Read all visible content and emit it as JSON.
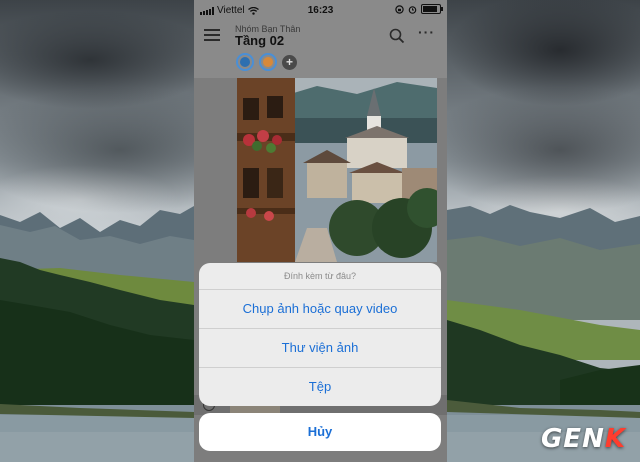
{
  "status_bar": {
    "carrier": "Viettel",
    "time": "16:23"
  },
  "header": {
    "subtitle": "Nhóm Bạn Thân",
    "title": "Tầng 02"
  },
  "action_sheet": {
    "title": "Đính kèm từ đâu?",
    "options": [
      {
        "label": "Chụp ảnh hoặc quay video"
      },
      {
        "label": "Thư viện ảnh"
      },
      {
        "label": "Tệp"
      }
    ],
    "cancel_label": "Hủy"
  },
  "watermark": {
    "text_main": "GEN",
    "text_accent": "K"
  },
  "colors": {
    "accent": "#1b6fd6",
    "watermark_accent": "#ff3d2e"
  },
  "icons": [
    "menu-icon",
    "search-icon",
    "more-icon",
    "wifi-icon",
    "battery-icon",
    "add-icon"
  ]
}
